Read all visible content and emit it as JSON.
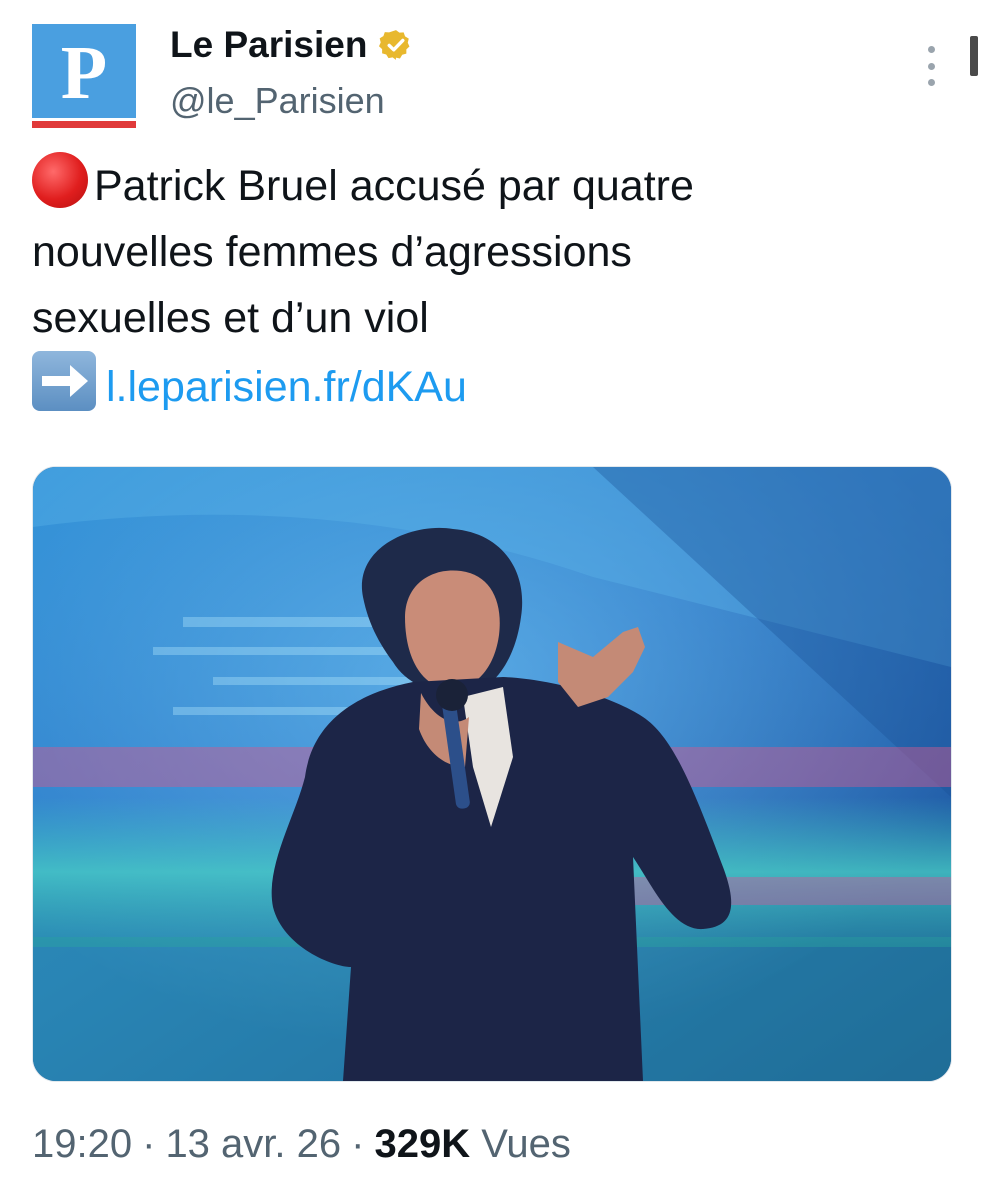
{
  "account": {
    "name": "Le Parisien",
    "handle": "@le_Parisien",
    "avatar_letter": "P",
    "verified_badge": "gold-check-badge-icon",
    "brand_colors": {
      "avatar_blue": "#4a9fe0",
      "avatar_red": "#e03a3a",
      "badge_gold": "#e8b82e"
    }
  },
  "tweet": {
    "text_line_1": "Patrick Bruel accusé par quatre",
    "text_line_2": "nouvelles femmes d’agressions",
    "text_line_3": "sexuelles et d’un viol",
    "leading_emoji": "red-circle-icon",
    "link_emoji": "right-arrow-icon",
    "link_text": "l.leparisien.fr/dKAu",
    "link_color": "#1d9bf0"
  },
  "media": {
    "icon": "photo-icon"
  },
  "meta": {
    "time": "19:20",
    "separator": "·",
    "date": "13 avr. 26",
    "views_count": "329K",
    "views_label": "Vues"
  }
}
